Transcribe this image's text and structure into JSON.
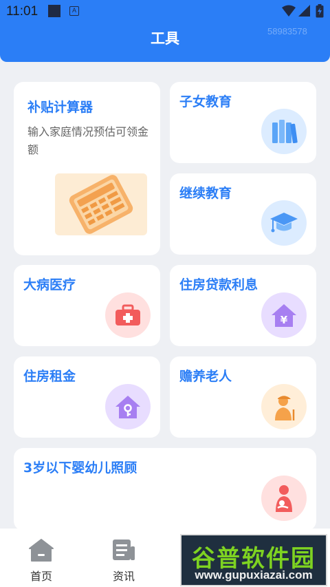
{
  "status_bar": {
    "time": "11:01",
    "notif_letter": "A"
  },
  "header": {
    "title": "工具",
    "id_watermark": "58983578"
  },
  "cards": {
    "subsidy": {
      "title": "补贴计算器",
      "desc": "输入家庭情况预估可领金额"
    },
    "children_edu": {
      "title": "子女教育"
    },
    "continuing_edu": {
      "title": "继续教育"
    },
    "medical": {
      "title": "大病医疗"
    },
    "housing_loan": {
      "title": "住房贷款利息"
    },
    "housing_rent": {
      "title": "住房租金"
    },
    "elderly": {
      "title": "赡养老人"
    },
    "infant_care": {
      "title": "3岁以下婴幼儿照顾"
    }
  },
  "bottom_nav": {
    "home": "首页",
    "news": "资讯"
  },
  "site_watermark": {
    "main": "谷普软件园",
    "url": "www.gupuxiazai.com"
  },
  "colors": {
    "primary": "#2b7ef6",
    "background": "#eef0f4"
  }
}
